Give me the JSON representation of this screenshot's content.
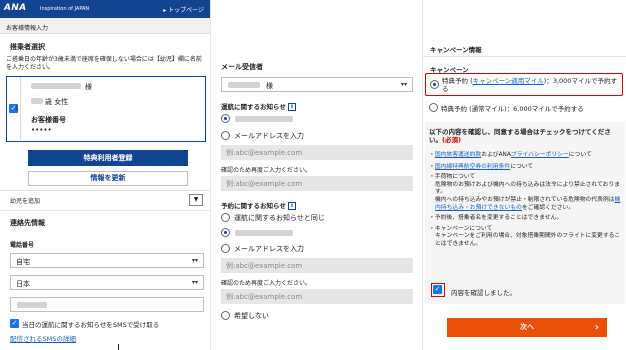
{
  "header": {
    "logo": "ANA",
    "tagline": "Inspiration of JAPAN",
    "top_link": "▸ トップページ"
  },
  "subheader": "お客様情報入力",
  "passenger_section": {
    "title": "搭乗者選択",
    "note": "ご搭乗日の年齢が3歳未満で座席を確保しない場合には【幼児】欄に名前を入力ください。",
    "name_suffix": "様",
    "age_gender": "歳 女性",
    "customer_number_label": "お客様番号",
    "customer_number_value": "•••••",
    "index": "1",
    "special_button": "特典利用者登録",
    "update_button": "情報を更新"
  },
  "infant": {
    "label": "幼児を追加"
  },
  "contact": {
    "title": "連絡先情報",
    "phone_label": "電話番号",
    "phone_type": "自宅",
    "phone_country": "日本",
    "sms_checkbox": "当日の運航に関するお知らせをSMSで受け取る",
    "sms_link": "配信されるSMSの詳細"
  },
  "email_panel": {
    "title": "メール受信者",
    "recipient_suffix": "様",
    "ops_notice_label": "運航に関するお知らせ",
    "info_icon": "i",
    "enter_email_label": "メールアドレスを入力",
    "email_placeholder": "例:abc@example.com",
    "confirm_label": "確認のため再度ご入力ください。",
    "confirm_placeholder": "例:abc@example.com",
    "booking_notice_label": "予約に関するお知らせ",
    "same_as_ops": "運航に関するお知らせと同じ",
    "enter_email_label2": "メールアドレスを入力",
    "email_placeholder2": "例:abc@example.com",
    "confirm_label2": "確認のため再度ご入力ください。",
    "confirm_placeholder2": "例:abc@example.com",
    "no_thanks": "希望しない"
  },
  "campaign": {
    "header": "キャンペーン情報",
    "section_label": "キャンペーン",
    "option1_pre": "特典予約 (",
    "option1_link": "キャンペーン適用マイル",
    "option1_post": ")：3,000マイルで予約する",
    "option2": "特典予約 (通常マイル)：6,000マイルで予約する",
    "confirm_heading": "以下の内容を確認し、同意する場合はチェックをつけてください。",
    "required": "(必須)",
    "bullets": [
      {
        "pre": "・",
        "link1": "国内旅客運送約款",
        "mid": "およびANA",
        "link2": "プライバシーポリシー",
        "post": "について"
      },
      {
        "pre": "・",
        "link1": "国内線特典航空券の利用条件",
        "mid": "について",
        "link2": "",
        "post": ""
      },
      {
        "pre": "・手荷物について",
        "link1": "",
        "mid": "",
        "link2": "",
        "post": ""
      },
      {
        "pre": "危険物のお預けおよび機内への持ち込みは法令により禁止されております。",
        "link1": "",
        "mid": "",
        "link2": "",
        "post": ""
      },
      {
        "pre": "機内への持ち込みやお預けが禁止・制限されている危険物の代表例は",
        "link1": "機内持ち込み・お預けできないもの",
        "mid": "をご確認ください。",
        "link2": "",
        "post": ""
      },
      {
        "pre": "・予約後、搭乗者名を変更することはできません。",
        "link1": "",
        "mid": "",
        "link2": "",
        "post": ""
      },
      {
        "pre": "・キャンペーンについて",
        "link1": "",
        "mid": "",
        "link2": "",
        "post": ""
      },
      {
        "pre": "キャンペーンをご利用の場合、対象搭乗期間外のフライトに変更することはできません。",
        "link1": "",
        "mid": "",
        "link2": "",
        "post": ""
      }
    ],
    "agree_label": "内容を確認しました。",
    "next_button": "次へ",
    "next_arrow": "›"
  },
  "colors": {
    "ana_navy": "#13448f",
    "next_orange": "#e8500a",
    "highlight_red": "#d40000",
    "checkbox_blue": "#1a73e8"
  }
}
